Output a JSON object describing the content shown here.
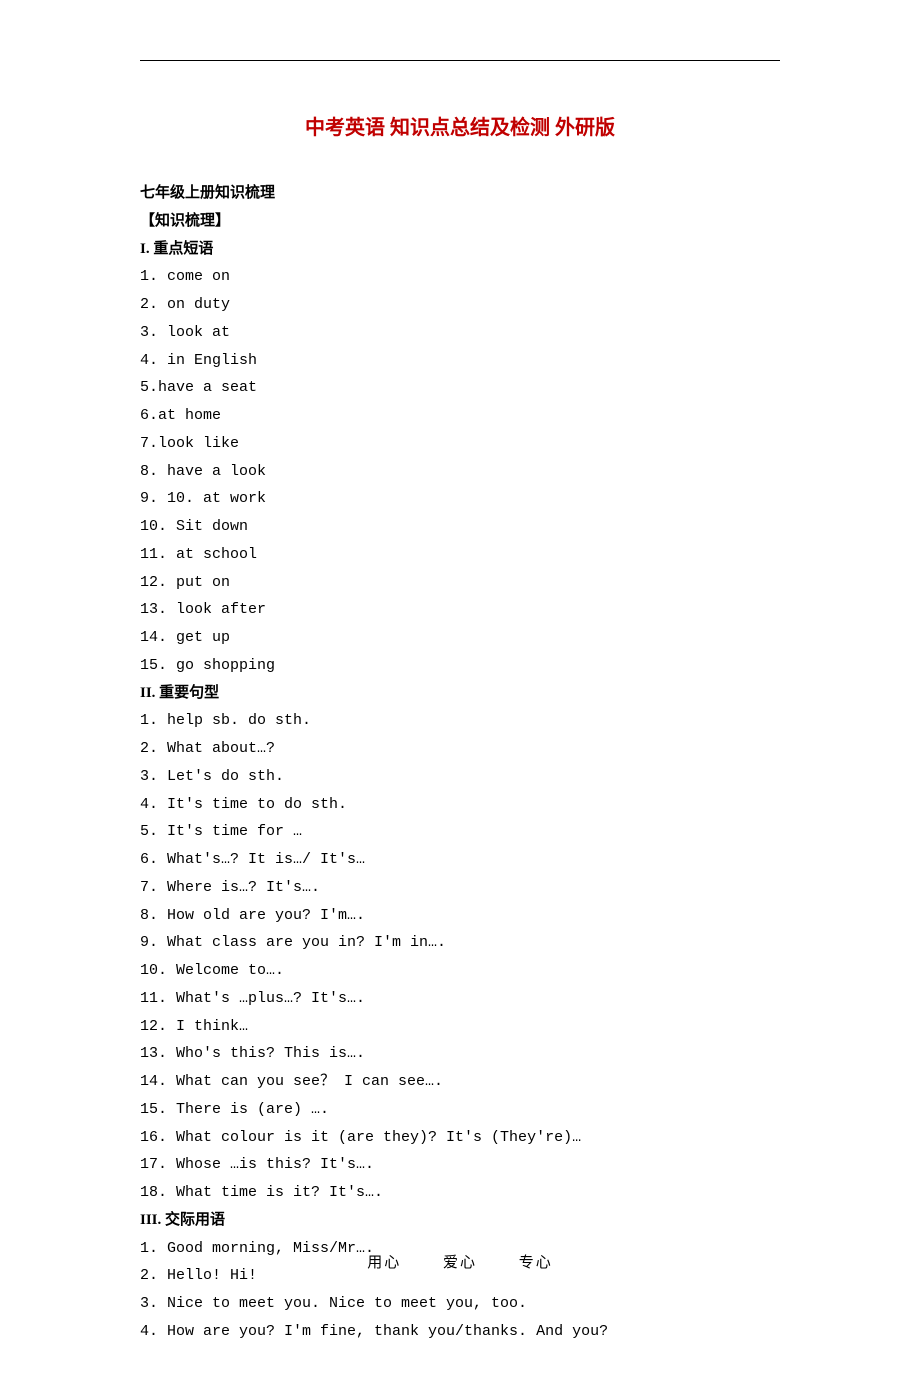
{
  "title": "中考英语 知识点总结及检测 外研版",
  "title_color": "#c00000",
  "subheading1": "七年级上册知识梳理",
  "subheading2": "【知识梳理】",
  "sections": {
    "s1": {
      "label": "I. 重点短语",
      "items": [
        "1. come on",
        "2. on duty",
        "3. look at",
        "4. in English",
        "5.have a seat",
        "6.at home",
        "7.look like",
        "8. have a look",
        "9. 10. at work",
        "10. Sit down",
        "11. at school",
        "12. put on",
        "13. look after",
        "14. get up",
        "15. go shopping"
      ]
    },
    "s2": {
      "label": "II. 重要句型",
      "items": [
        "1. help sb. do sth.",
        "2. What about…?",
        "3. Let's do sth.",
        "4. It's time to do sth.",
        "5. It's time for …",
        "6. What's…? It is…/ It's…",
        "7. Where is…? It's….",
        "8. How old are you? I'm….",
        "9. What class are you in? I'm in….",
        "10. Welcome to….",
        "11. What's …plus…? It's….",
        "12. I think…",
        "13. Who's this? This is….",
        "14. What can you see？ I can see….",
        "15. There is (are) ….",
        "16. What colour is it (are they)? It's (They're)…",
        "17. Whose …is this? It's….",
        "18. What time is it? It's…."
      ]
    },
    "s3": {
      "label": "III. 交际用语",
      "items": [
        "1. Good morning, Miss/Mr….",
        "2. Hello! Hi!",
        "3. Nice to meet you. Nice to meet you, too.",
        "4. How are you? I'm fine, thank you/thanks. And you?"
      ]
    }
  },
  "footer": {
    "a": "用心",
    "b": "爱心",
    "c": "专心"
  }
}
